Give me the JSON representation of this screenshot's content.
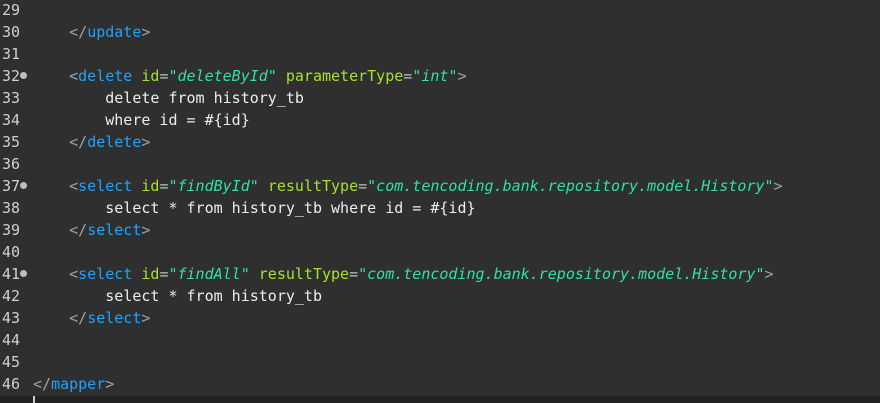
{
  "editor": {
    "lines": [
      {
        "num": "29",
        "fold": false,
        "code": ""
      },
      {
        "num": "30",
        "fold": false,
        "code": "    </update>"
      },
      {
        "num": "31",
        "fold": false,
        "code": ""
      },
      {
        "num": "32",
        "fold": true,
        "code": "    <delete id=\"deleteById\" parameterType=\"int\">"
      },
      {
        "num": "33",
        "fold": false,
        "code": "        delete from history_tb"
      },
      {
        "num": "34",
        "fold": false,
        "code": "        where id = #{id}"
      },
      {
        "num": "35",
        "fold": false,
        "code": "    </delete>"
      },
      {
        "num": "36",
        "fold": false,
        "code": ""
      },
      {
        "num": "37",
        "fold": true,
        "code": "    <select id=\"findById\" resultType=\"com.tencoding.bank.repository.model.History\">"
      },
      {
        "num": "38",
        "fold": false,
        "code": "        select * from history_tb where id = #{id}"
      },
      {
        "num": "39",
        "fold": false,
        "code": "    </select>"
      },
      {
        "num": "40",
        "fold": false,
        "code": ""
      },
      {
        "num": "41",
        "fold": true,
        "code": "    <select id=\"findAll\" resultType=\"com.tencoding.bank.repository.model.History\">"
      },
      {
        "num": "42",
        "fold": false,
        "code": "        select * from history_tb"
      },
      {
        "num": "43",
        "fold": false,
        "code": "    </select>"
      },
      {
        "num": "44",
        "fold": false,
        "code": ""
      },
      {
        "num": "45",
        "fold": false,
        "code": ""
      },
      {
        "num": "46",
        "fold": false,
        "code": "</mapper>"
      }
    ]
  },
  "colors": {
    "background": "#2f2f2f",
    "tag": "#1ea3ff",
    "attribute": "#a6e22e",
    "string": "#2fe0a8",
    "text": "#e8eef5"
  }
}
